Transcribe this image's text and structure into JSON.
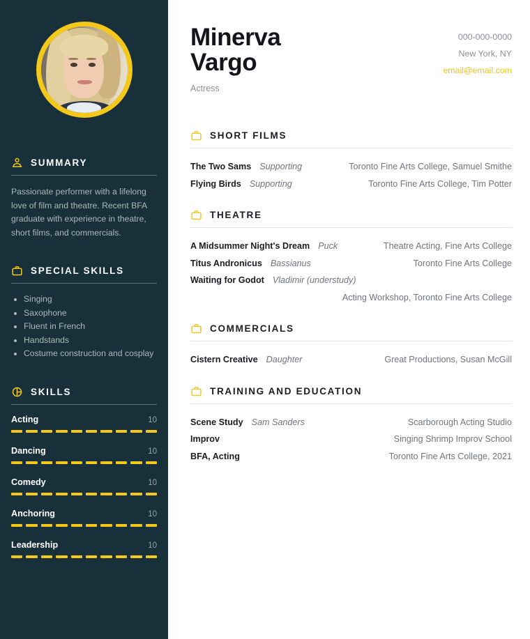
{
  "theme": {
    "sidebar_bg": "#17303a",
    "accent": "#f4c81a",
    "text_dark": "#1a1e22",
    "text_muted": "#6f767c",
    "sidebar_text_muted": "#aeb8bd"
  },
  "header": {
    "first_name": "Minerva",
    "last_name": "Vargo",
    "role": "Actress",
    "contact": {
      "phone": "000-000-0000",
      "location": "New York, NY",
      "email": "email@email.com"
    }
  },
  "sidebar": {
    "photo_alt": "portrait-photo",
    "sections": [
      {
        "id": "summary",
        "icon": "person-icon",
        "title": "SUMMARY",
        "body": "Passionate performer with a lifelong love of film and theatre. Recent BFA graduate with experience in theatre, short films, and commercials."
      },
      {
        "id": "special-skills",
        "icon": "briefcase-icon",
        "title": "SPECIAL SKILLS",
        "items": [
          "Singing",
          "Saxophone",
          "Fluent in French",
          "Handstands",
          "Costume construction and cosplay"
        ]
      },
      {
        "id": "skills",
        "icon": "pie-chart-icon",
        "title": "SKILLS",
        "bars": [
          {
            "name": "Acting",
            "value": "10",
            "filled": 10,
            "total": 10
          },
          {
            "name": "Dancing",
            "value": "10",
            "filled": 10,
            "total": 10
          },
          {
            "name": "Comedy",
            "value": "10",
            "filled": 10,
            "total": 10
          },
          {
            "name": "Anchoring",
            "value": "10",
            "filled": 10,
            "total": 10
          },
          {
            "name": "Leadership",
            "value": "10",
            "filled": 10,
            "total": 10
          }
        ]
      }
    ]
  },
  "main": {
    "sections": [
      {
        "id": "short-films",
        "icon": "briefcase-icon",
        "title": "SHORT FILMS",
        "rows": [
          {
            "title": "The Two Sams",
            "role": "Supporting",
            "detail": "Toronto Fine Arts College, Samuel Smithe"
          },
          {
            "title": "Flying Birds",
            "role": "Supporting",
            "detail": "Toronto Fine Arts College, Tim Potter"
          }
        ]
      },
      {
        "id": "theatre",
        "icon": "briefcase-icon",
        "title": "THEATRE",
        "rows": [
          {
            "title": "A Midsummer Night's Dream",
            "role": "Puck",
            "detail": "Theatre Acting, Fine Arts College"
          },
          {
            "title": "Titus Andronicus",
            "role": "Bassianus",
            "detail": "Toronto Fine Arts College"
          },
          {
            "title": "Waiting for Godot",
            "role": "Vladimir (understudy)",
            "detail": "Acting Workshop, Toronto Fine Arts College"
          }
        ]
      },
      {
        "id": "commercials",
        "icon": "briefcase-icon",
        "title": "COMMERCIALS",
        "rows": [
          {
            "title": "Cistern Creative",
            "role": "Daughter",
            "detail": "Great Productions, Susan McGill"
          }
        ]
      },
      {
        "id": "training-and-education",
        "icon": "briefcase-icon",
        "title": "TRAINING AND EDUCATION",
        "rows": [
          {
            "title": "Scene Study",
            "role": "Sam Sanders",
            "detail": "Scarborough Acting Studio"
          },
          {
            "title": "Improv",
            "role": "",
            "detail": "Singing Shrimp Improv School"
          },
          {
            "title": "BFA, Acting",
            "role": "",
            "detail": "Toronto Fine Arts College, 2021"
          }
        ]
      }
    ]
  }
}
